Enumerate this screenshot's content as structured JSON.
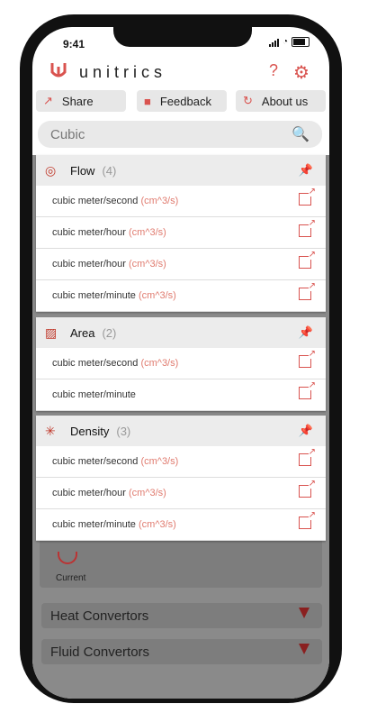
{
  "status": {
    "time": "9:41"
  },
  "header": {
    "brand": "unitrics",
    "help_glyph": "?",
    "settings_glyph": "⚙"
  },
  "toolbar": {
    "share_label": "Share",
    "feedback_label": "Feedback",
    "about_label": "About us"
  },
  "search": {
    "value": "Cubic"
  },
  "background": {
    "current_label": "Current",
    "heat_label": "Heat Convertors",
    "fluid_label": "Fluid Convertors"
  },
  "panels": [
    {
      "title": "Flow",
      "count": "(4)",
      "rows": [
        {
          "label": "cubic meter/second",
          "unit": "(cm^3/s)"
        },
        {
          "label": "cubic meter/hour",
          "unit": "(cm^3/s)"
        },
        {
          "label": "cubic meter/hour",
          "unit": "(cm^3/s)"
        },
        {
          "label": "cubic meter/minute",
          "unit": "(cm^3/s)"
        }
      ]
    },
    {
      "title": "Area",
      "count": "(2)",
      "rows": [
        {
          "label": "cubic meter/second",
          "unit": "(cm^3/s)"
        },
        {
          "label": "cubic meter/minute",
          "unit": ""
        }
      ]
    },
    {
      "title": "Density",
      "count": "(3)",
      "rows": [
        {
          "label": "cubic meter/second",
          "unit": "(cm^3/s)"
        },
        {
          "label": "cubic meter/hour",
          "unit": "(cm^3/s)"
        },
        {
          "label": "cubic meter/minute",
          "unit": "(cm^3/s)"
        }
      ]
    }
  ],
  "colors": {
    "accent": "#d9534f",
    "overlay": "#8a8a8a"
  },
  "icons": [
    "logo-icon",
    "help-icon",
    "gear-icon",
    "share-icon",
    "feedback-icon",
    "about-icon",
    "search-icon",
    "pin-icon",
    "open-external-icon",
    "chevron-down-icon"
  ]
}
